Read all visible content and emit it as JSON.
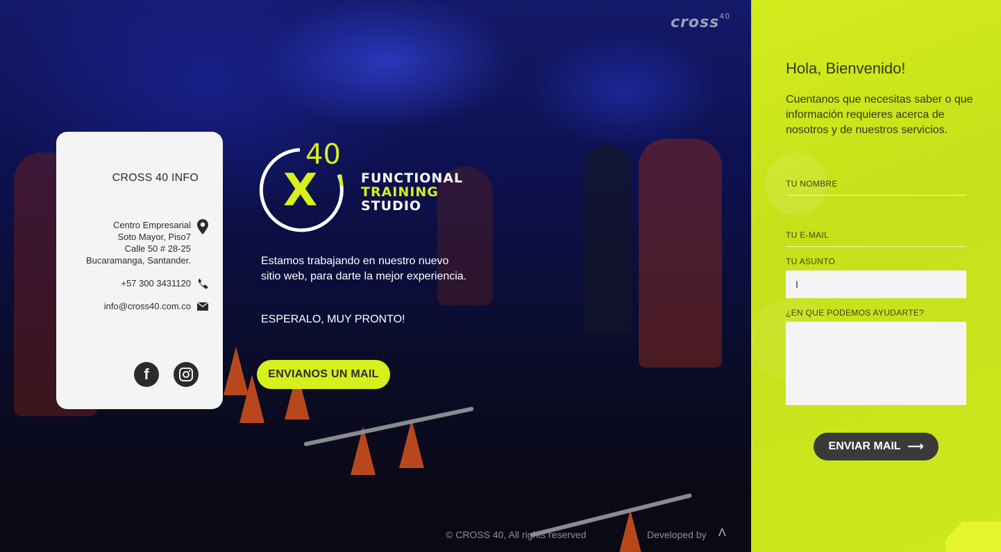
{
  "brand": {
    "corner_logo": "cross",
    "corner_logo_sup": "40"
  },
  "info_card": {
    "title": "CROSS 40 INFO",
    "address_lines": [
      "Centro Empresarial",
      "Soto Mayor, Piso7",
      "Calle 50 # 28-25",
      "Bucaramanga, Santander."
    ],
    "phone": "+57 300 3431120",
    "email": "info@cross40.com.co",
    "icons": {
      "address": "map-pin-icon",
      "phone": "phone-icon",
      "email": "envelope-icon"
    },
    "socials": [
      {
        "name": "facebook-icon",
        "glyph": "f"
      },
      {
        "name": "instagram-icon",
        "glyph": "◎"
      }
    ]
  },
  "logo": {
    "number": "40",
    "mark": "X",
    "line1": "FUNCTIONAL",
    "line2": "TRAINING",
    "line3": "STUDIO"
  },
  "hero": {
    "message": "Estamos trabajando en nuestro nuevo sitio web, para darte la mejor experiencia.",
    "cta_text": "ESPERALO, MUY PRONTO!",
    "button_label": "ENVIANOS UN MAIL"
  },
  "footer": {
    "copyright": "© CROSS 40, All rights reserved",
    "developed_by": "Developed by",
    "dev_logo": "Λ"
  },
  "form": {
    "title": "Hola, Bienvenido!",
    "subtitle": "Cuentanos que necesitas saber o que información requieres acerca de nosotros y de nuestros servicios.",
    "name_label": "TU NOMBRE",
    "email_label": "TU E-MAIL",
    "subject_label": "TU ASUNTO",
    "subject_value": "I",
    "message_label": "¿EN QUE PODEMOS AYUDARTE?",
    "submit_label": "ENVIAR MAIL",
    "submit_arrow": "⟶"
  },
  "colors": {
    "accent": "#d7ef1a",
    "dark": "#2b2b2b",
    "card": "#f4f4f4",
    "hero_blue": "#141a6a"
  }
}
